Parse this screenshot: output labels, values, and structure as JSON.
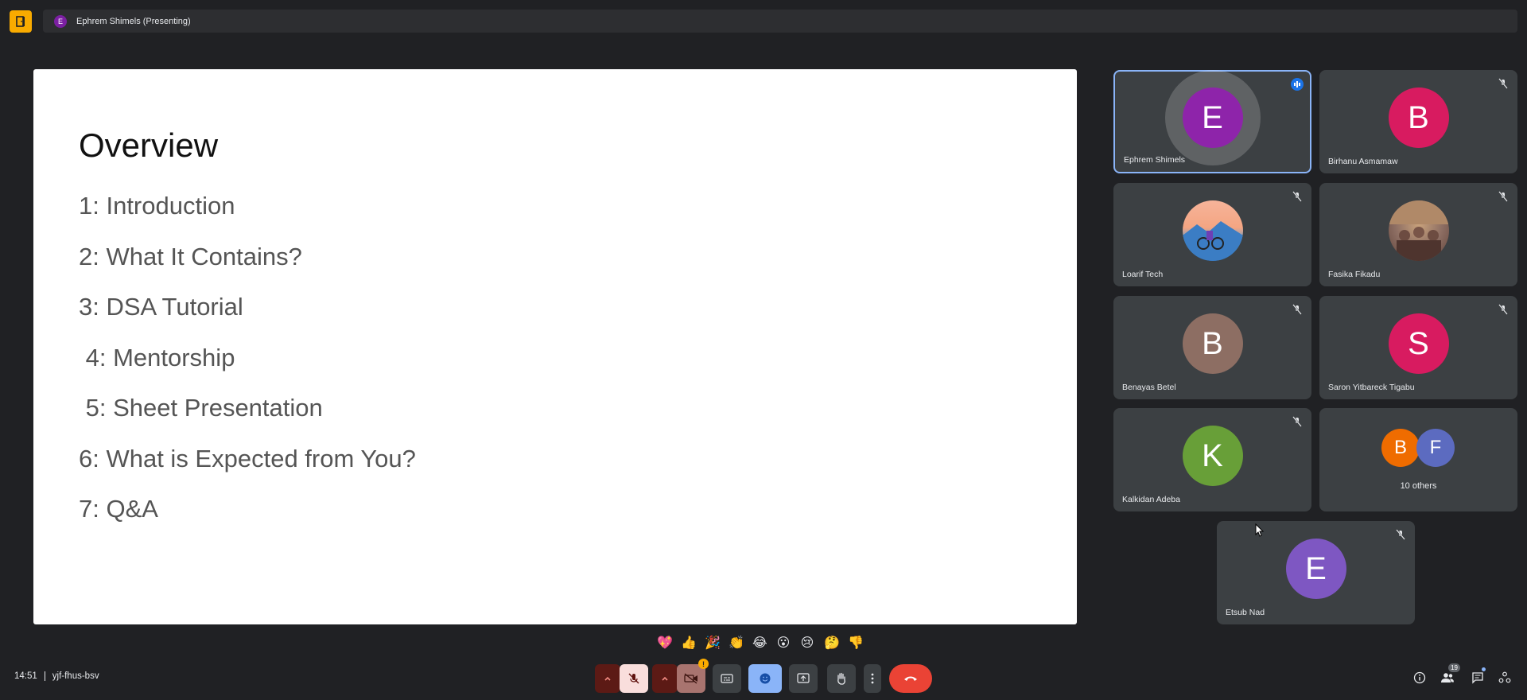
{
  "topbar": {
    "presenter_initial": "E",
    "presenter_label": "Ephrem Shimels (Presenting)"
  },
  "slide": {
    "title": "Overview",
    "items": [
      "1: Introduction",
      "2: What It Contains?",
      "3: DSA Tutorial",
      " 4: Mentorship",
      " 5: Sheet Presentation",
      "6: What is Expected from You?",
      "7: Q&A"
    ]
  },
  "participants": [
    {
      "name": "Ephrem Shimels",
      "initial": "E",
      "color": "#8e24aa",
      "state": "speaking"
    },
    {
      "name": "Birhanu Asmamaw",
      "initial": "B",
      "color": "#d81b60",
      "state": "muted"
    },
    {
      "name": "Loarif Tech",
      "initial": "",
      "color": "#f4a582",
      "state": "muted",
      "image": "cyclists-photo"
    },
    {
      "name": "Fasika Fikadu",
      "initial": "",
      "color": "#8d6e63",
      "state": "muted",
      "image": "group-photo"
    },
    {
      "name": "Benayas Betel",
      "initial": "B",
      "color": "#8d6e63",
      "state": "muted"
    },
    {
      "name": "Saron Yitbareck Tigabu",
      "initial": "S",
      "color": "#d81b60",
      "state": "muted"
    },
    {
      "name": "Kalkidan Adeba",
      "initial": "K",
      "color": "#689f38",
      "state": "muted"
    },
    {
      "name": "Etsub Nad",
      "initial": "E",
      "color": "#7e57c2",
      "state": "muted"
    }
  ],
  "others": {
    "label": "10 others",
    "initials": [
      "B",
      "F"
    ],
    "colors": [
      "#ef6c00",
      "#5c6bc0"
    ]
  },
  "reactions": [
    "💖",
    "👍",
    "🎉",
    "👏",
    "😂",
    "😮",
    "😢",
    "🤔",
    "👎"
  ],
  "meeting": {
    "time": "14:51",
    "code": "yjf-fhus-bsv"
  },
  "people_count": "19",
  "colors": {
    "background": "#202124",
    "tile": "#3c4043",
    "end_call": "#ea4335",
    "active_border": "#8ab4f8"
  }
}
